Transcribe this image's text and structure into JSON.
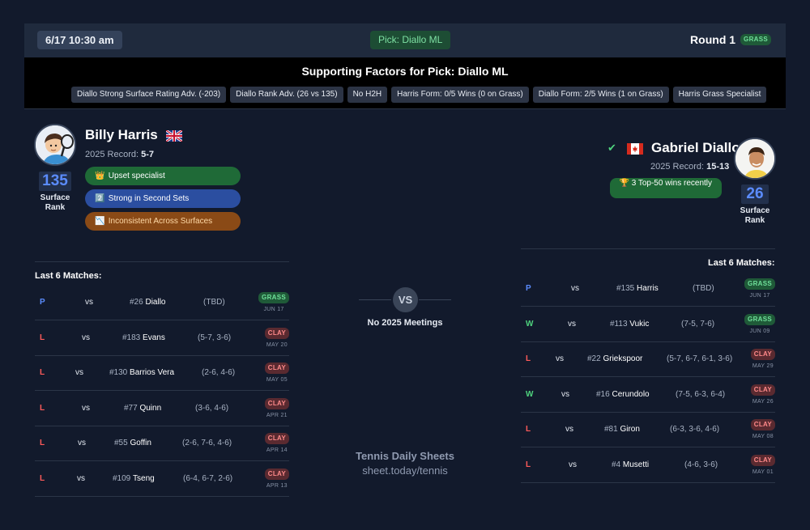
{
  "header": {
    "datetime": "6/17 10:30 am",
    "pick": "Pick: Diallo ML",
    "round": "Round 1",
    "surface": "GRASS"
  },
  "factors": {
    "title": "Supporting Factors for Pick: Diallo ML",
    "chips": [
      "Diallo Strong Surface Rating Adv. (-203)",
      "Diallo Rank Adv. (26 vs 135)",
      "No H2H",
      "Harris Form: 0/5 Wins (0 on Grass)",
      "Diallo Form: 2/5 Wins (1 on Grass)",
      "Harris Grass Specialist"
    ]
  },
  "left_player": {
    "name": "Billy Harris",
    "flag_icon": "uk-flag-icon",
    "record_label": "2025 Record:",
    "record": "5-7",
    "surface_rank": "135",
    "surface_rank_label": "Surface Rank",
    "tags": [
      {
        "icon": "crown-icon",
        "glyph": "👑",
        "text": "Upset specialist",
        "color": "#1f6a37"
      },
      {
        "icon": "number-two-icon",
        "glyph": "2️⃣",
        "text": "Strong in Second Sets",
        "color": "#2b4ea0"
      },
      {
        "icon": "chart-icon",
        "glyph": "📉",
        "text": "Inconsistent Across Surfaces",
        "color": "#8a4a16"
      }
    ],
    "matches_title": "Last 6 Matches:",
    "matches": [
      {
        "result": "P",
        "vs": "vs",
        "rank": "#26",
        "opponent": "Diallo",
        "score": "(TBD)",
        "surface": "GRASS",
        "date": "JUN 17"
      },
      {
        "result": "L",
        "vs": "vs",
        "rank": "#183",
        "opponent": "Evans",
        "score": "(5-7, 3-6)",
        "surface": "CLAY",
        "date": "MAY 20"
      },
      {
        "result": "L",
        "vs": "vs",
        "rank": "#130",
        "opponent": "Barrios Vera",
        "score": "(2-6, 4-6)",
        "surface": "CLAY",
        "date": "MAY 05"
      },
      {
        "result": "L",
        "vs": "vs",
        "rank": "#77",
        "opponent": "Quinn",
        "score": "(3-6, 4-6)",
        "surface": "CLAY",
        "date": "APR 21"
      },
      {
        "result": "L",
        "vs": "vs",
        "rank": "#55",
        "opponent": "Goffin",
        "score": "(2-6, 7-6, 4-6)",
        "surface": "CLAY",
        "date": "APR 14"
      },
      {
        "result": "L",
        "vs": "vs",
        "rank": "#109",
        "opponent": "Tseng",
        "score": "(6-4, 6-7, 2-6)",
        "surface": "CLAY",
        "date": "APR 13"
      }
    ]
  },
  "right_player": {
    "name": "Gabriel Diallo",
    "flag_icon": "canada-flag-icon",
    "record_label": "2025 Record:",
    "record": "15-13",
    "surface_rank": "26",
    "surface_rank_label": "Surface Rank",
    "tags": [
      {
        "icon": "trophy-icon",
        "glyph": "🏆",
        "text": "3 Top-50 wins recently",
        "color": "#1f6a37"
      }
    ],
    "matches_title": "Last 6 Matches:",
    "matches": [
      {
        "result": "P",
        "vs": "vs",
        "rank": "#135",
        "opponent": "Harris",
        "score": "(TBD)",
        "surface": "GRASS",
        "date": "JUN 17"
      },
      {
        "result": "W",
        "vs": "vs",
        "rank": "#113",
        "opponent": "Vukic",
        "score": "(7-5, 7-6)",
        "surface": "GRASS",
        "date": "JUN 09"
      },
      {
        "result": "L",
        "vs": "vs",
        "rank": "#22",
        "opponent": "Griekspoor",
        "score": "(5-7, 6-7, 6-1, 3-6)",
        "surface": "CLAY",
        "date": "MAY 29"
      },
      {
        "result": "W",
        "vs": "vs",
        "rank": "#16",
        "opponent": "Cerundolo",
        "score": "(7-5, 6-3, 6-4)",
        "surface": "CLAY",
        "date": "MAY 26"
      },
      {
        "result": "L",
        "vs": "vs",
        "rank": "#81",
        "opponent": "Giron",
        "score": "(6-3, 3-6, 4-6)",
        "surface": "CLAY",
        "date": "MAY 08"
      },
      {
        "result": "L",
        "vs": "vs",
        "rank": "#4",
        "opponent": "Musetti",
        "score": "(4-6, 3-6)",
        "surface": "CLAY",
        "date": "MAY 01"
      }
    ]
  },
  "h2h": {
    "vs": "VS",
    "text": "No 2025 Meetings"
  },
  "footer": {
    "brand": "Tennis Daily Sheets",
    "url": "sheet.today/tennis"
  }
}
